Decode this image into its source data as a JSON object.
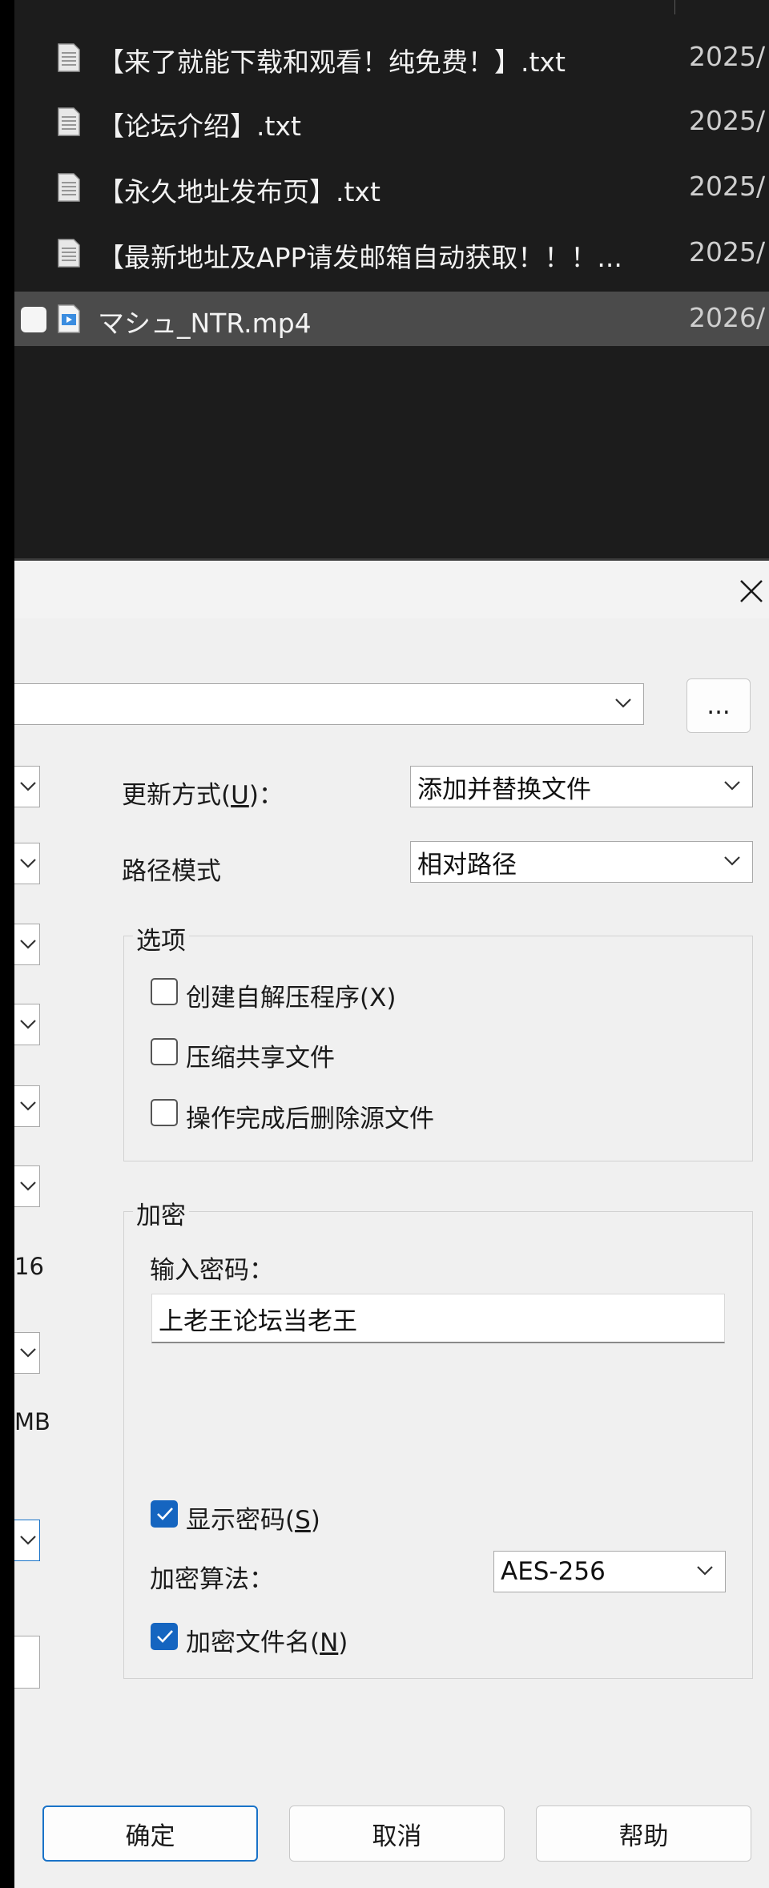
{
  "file_list": {
    "rows": [
      {
        "name": "【来了就能下载和观看！纯免费！】.txt",
        "date": "2025/",
        "type": "txt",
        "selected": false
      },
      {
        "name": "【论坛介绍】.txt",
        "date": "2025/",
        "type": "txt",
        "selected": false
      },
      {
        "name": "【永久地址发布页】.txt",
        "date": "2025/",
        "type": "txt",
        "selected": false
      },
      {
        "name": "【最新地址及APP请发邮箱自动获取！！！...",
        "date": "2025/",
        "type": "txt",
        "selected": false
      },
      {
        "name": "マシュ_NTR.mp4",
        "date": "2026/",
        "type": "mp4",
        "selected": true
      }
    ]
  },
  "dialog": {
    "browse_label": "...",
    "update_mode": {
      "label": "更新方式",
      "hotkey": "U",
      "suffix": "：",
      "value": "添加并替换文件"
    },
    "path_mode": {
      "label": "路径模式",
      "value": "相对路径"
    },
    "left_stub_values": [
      "16",
      "MB"
    ],
    "options": {
      "title": "选项",
      "items": [
        {
          "label": "创建自解压程序(X)",
          "checked": false
        },
        {
          "label": "压缩共享文件",
          "checked": false
        },
        {
          "label": "操作完成后删除源文件",
          "checked": false
        }
      ]
    },
    "encryption": {
      "title": "加密",
      "password_label": "输入密码：",
      "password_value": "上老王论坛当老王",
      "show_password": {
        "label_prefix": "显示密码(",
        "hotkey": "S",
        "label_suffix": ")",
        "checked": true
      },
      "algorithm_label": "加密算法：",
      "algorithm_value": "AES-256",
      "encrypt_names": {
        "label_prefix": "加密文件名(",
        "hotkey": "N",
        "label_suffix": ")",
        "checked": true
      }
    },
    "buttons": {
      "ok": "确定",
      "cancel": "取消",
      "help": "帮助"
    }
  },
  "colors": {
    "accent": "#1565c0",
    "dark_bg": "#1c1c1c",
    "selected_row": "#4b4b4b"
  }
}
